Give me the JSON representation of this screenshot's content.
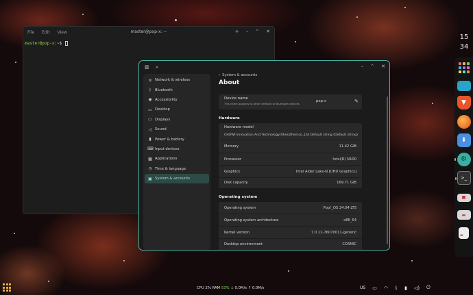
{
  "clock": {
    "hour": "15",
    "minute": "34"
  },
  "dock": [
    {
      "icon": "app-grid-icon",
      "color": "#f0a030"
    },
    {
      "icon": "folder-icon",
      "color": "#2aa3c9"
    },
    {
      "icon": "brave-browser-icon",
      "color": "#e8552c"
    },
    {
      "icon": "firefox-icon",
      "color": "#e66b1f"
    },
    {
      "icon": "store-icon",
      "color": "#4a8fe0"
    },
    {
      "icon": "settings-icon",
      "color": "#3bb0a0"
    },
    {
      "icon": "terminal-icon",
      "color": "#303030"
    },
    {
      "icon": "printer-icon",
      "color": "#d0d0d0"
    },
    {
      "icon": "media-icon",
      "color": "#d0d0d0"
    },
    {
      "icon": "text-editor-icon",
      "color": "#d0d0d0"
    }
  ],
  "terminal": {
    "menu": [
      "File",
      "Edit",
      "View"
    ],
    "title": "master@pop-x: ~",
    "prompt_user": "master@pop-x",
    "prompt_rest": ":~$ "
  },
  "settings": {
    "sidebar": [
      {
        "icon": "wifi-icon",
        "glyph": "≋",
        "label": "Network & wireless"
      },
      {
        "icon": "bluetooth-icon",
        "glyph": "ᛒ",
        "label": "Bluetooth"
      },
      {
        "icon": "accessibility-icon",
        "glyph": "◉",
        "label": "Accessibility"
      },
      {
        "icon": "desktop-icon",
        "glyph": "▭",
        "label": "Desktop"
      },
      {
        "icon": "display-icon",
        "glyph": "▭",
        "label": "Displays"
      },
      {
        "icon": "sound-icon",
        "glyph": "◁",
        "label": "Sound"
      },
      {
        "icon": "power-icon",
        "glyph": "▮",
        "label": "Power & battery"
      },
      {
        "icon": "input-devices-icon",
        "glyph": "⌨",
        "label": "Input devices"
      },
      {
        "icon": "applications-icon",
        "glyph": "▦",
        "label": "Applications"
      },
      {
        "icon": "time-language-icon",
        "glyph": "◷",
        "label": "Time & language"
      },
      {
        "icon": "system-icon",
        "glyph": "▣",
        "label": "System & accounts"
      }
    ],
    "breadcrumb": "System & accounts",
    "page_title": "About",
    "device": {
      "label": "Device name",
      "hint": "This name appears to other network or Bluetooth devices",
      "value": "pop-x"
    },
    "hardware_heading": "Hardware",
    "hardware": {
      "model_label": "Hardware model",
      "model_value": "CHUWI Innovation And Technology(ShenZhen)co.,Ltd Default string (Default string)",
      "rows": [
        {
          "label": "Memory",
          "value": "11.42 GiB"
        },
        {
          "label": "Processor",
          "value": "Intel(R) N100"
        },
        {
          "label": "Graphics",
          "value": "Intel Alder Lake-N [UHD Graphics]"
        },
        {
          "label": "Disk capacity",
          "value": "169.71 GiB"
        }
      ]
    },
    "os_heading": "Operating system",
    "os": [
      {
        "label": "Operating system",
        "value": "Pop!_OS 24.04 LTS"
      },
      {
        "label": "Operating system architecture",
        "value": "x86_64"
      },
      {
        "label": "Kernel version",
        "value": "7.0.11-76070011-generic"
      },
      {
        "label": "Desktop environment",
        "value": "COSMIC"
      }
    ]
  },
  "statusbar": {
    "cpu_label": "CPU",
    "cpu_value": "2%",
    "ram_label": "RAM",
    "ram_value": "53%",
    "net": "↓ 0.0M/s ↑ 0.0M/s"
  },
  "tray": {
    "keyboard": "US"
  }
}
